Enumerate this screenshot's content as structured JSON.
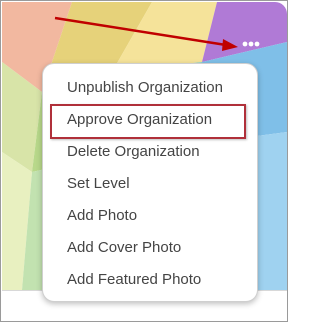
{
  "menu": {
    "items": [
      {
        "label": "Unpublish Organization"
      },
      {
        "label": "Approve Organization"
      },
      {
        "label": "Delete Organization"
      },
      {
        "label": "Set Level"
      },
      {
        "label": "Add Photo"
      },
      {
        "label": "Add Cover Photo"
      },
      {
        "label": "Add Featured Photo"
      }
    ],
    "highlighted_item": "Approve Organization"
  },
  "icons": {
    "more": "more-horizontal-icon"
  },
  "colors": {
    "highlight_border": "#b0303a",
    "arrow": "#c00000",
    "menu_text": "#444444"
  }
}
